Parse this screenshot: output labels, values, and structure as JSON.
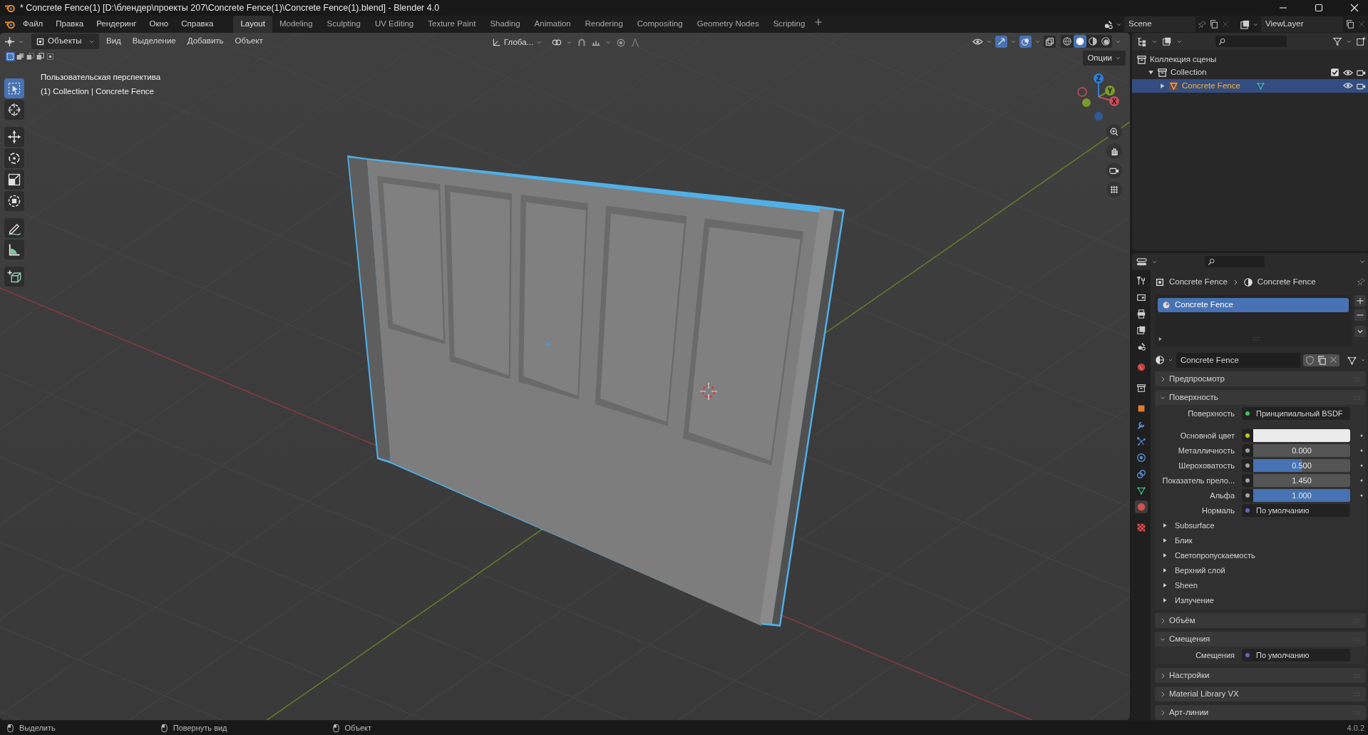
{
  "window": {
    "title": "* Concrete Fence(1) [D:\\блендер\\проекты 207\\Concrete Fence(1)\\Concrete Fence(1).blend] - Blender 4.0"
  },
  "menu": [
    "Файл",
    "Правка",
    "Рендеринг",
    "Окно",
    "Справка"
  ],
  "workspaces": [
    {
      "label": "Layout",
      "selected": true
    },
    {
      "label": "Modeling",
      "selected": false
    },
    {
      "label": "Sculpting",
      "selected": false
    },
    {
      "label": "UV Editing",
      "selected": false
    },
    {
      "label": "Texture Paint",
      "selected": false
    },
    {
      "label": "Shading",
      "selected": false
    },
    {
      "label": "Animation",
      "selected": false
    },
    {
      "label": "Rendering",
      "selected": false
    },
    {
      "label": "Compositing",
      "selected": false
    },
    {
      "label": "Geometry Nodes",
      "selected": false
    },
    {
      "label": "Scripting",
      "selected": false
    }
  ],
  "scene": "Scene",
  "view_layer": "ViewLayer",
  "viewport": {
    "mode": "Объекты",
    "menus": [
      "Вид",
      "Выделение",
      "Добавить",
      "Объект"
    ],
    "orientation": "Глоба...",
    "options": "Опции",
    "toggles": [
      {
        "kind": "gizmo",
        "on": true
      },
      {
        "kind": "overlay",
        "on": true
      },
      {
        "kind": "xray",
        "on": false
      }
    ],
    "shading": [
      {
        "kind": "wire",
        "selected": false
      },
      {
        "kind": "solid",
        "selected": true
      },
      {
        "kind": "material",
        "selected": false
      },
      {
        "kind": "render",
        "selected": false
      }
    ],
    "select_modes": [
      {
        "selected": true
      },
      {
        "selected": false
      },
      {
        "selected": false
      },
      {
        "selected": false
      },
      {
        "selected": false
      }
    ],
    "overlay_text": [
      "Пользовательская перспектива",
      "(1) Collection | Concrete Fence"
    ],
    "tools": [
      {
        "kind": "select",
        "selected": true
      },
      {
        "kind": "cursor",
        "selected": false
      },
      {
        "kind": "move",
        "selected": false
      },
      {
        "kind": "rotate",
        "selected": false
      },
      {
        "kind": "scale",
        "selected": false
      },
      {
        "kind": "transform",
        "selected": false
      },
      {
        "kind": "annotate",
        "selected": false
      },
      {
        "kind": "measure",
        "selected": false
      },
      {
        "kind": "add_cube",
        "selected": false
      }
    ],
    "gizmo_axes": [
      "Z",
      "Y",
      "X"
    ]
  },
  "outliner": {
    "items": [
      {
        "label": "Коллекция сцены",
        "kind": "scene_collection",
        "children": [
          {
            "label": "Collection",
            "kind": "collection",
            "expanded": true,
            "checked": true,
            "selected": false,
            "children": [
              {
                "label": "Concrete Fence",
                "kind": "object",
                "expanded": false,
                "selected": true
              }
            ]
          }
        ]
      }
    ]
  },
  "properties": {
    "tabs": [
      {
        "kind": "tool",
        "selected": false
      },
      {
        "kind": "render",
        "selected": false
      },
      {
        "kind": "output",
        "selected": false
      },
      {
        "kind": "view_layer",
        "selected": false
      },
      {
        "kind": "scene",
        "selected": false
      },
      {
        "kind": "world",
        "selected": false
      },
      {
        "kind": "collection",
        "selected": false
      },
      {
        "kind": "object",
        "selected": false
      },
      {
        "kind": "modifiers",
        "selected": false
      },
      {
        "kind": "particles",
        "selected": false
      },
      {
        "kind": "physics",
        "selected": false
      },
      {
        "kind": "constraints",
        "selected": false
      },
      {
        "kind": "data",
        "selected": false
      },
      {
        "kind": "material",
        "selected": true
      },
      {
        "kind": "texture",
        "selected": false
      }
    ],
    "breadcrumb": [
      "Concrete Fence",
      "Concrete Fence"
    ],
    "material_slots": [
      {
        "label": "Concrete Fence",
        "selected": true
      }
    ],
    "material_name": "Concrete Fence",
    "panels": [
      {
        "title": "Предпросмотр",
        "expanded": false
      },
      {
        "title": "Поверхность",
        "expanded": true,
        "rows": [
          {
            "kind": "link",
            "label": "Поверхность",
            "value": "Принципиальный BSDF",
            "color": "#3fbf5f"
          },
          {
            "kind": "color",
            "label": "Основной цвет",
            "color": "#ebebeb"
          },
          {
            "kind": "slider",
            "label": "Металличность",
            "value": "0.000",
            "level": 0
          },
          {
            "kind": "slider",
            "label": "Шероховатость",
            "value": "0.500",
            "level": 0.5
          },
          {
            "kind": "slider",
            "label": "Показатель прело...",
            "value": "1.450",
            "level": 0
          },
          {
            "kind": "slider",
            "label": "Альфа",
            "value": "1.000",
            "level": 1
          },
          {
            "kind": "link",
            "label": "Нормаль",
            "value": "По умолчанию",
            "color": "#6363c7"
          },
          {
            "kind": "subpanel",
            "label": "Subsurface"
          },
          {
            "kind": "subpanel",
            "label": "Блик"
          },
          {
            "kind": "subpanel",
            "label": "Светопропускаемость"
          },
          {
            "kind": "subpanel",
            "label": "Верхний слой"
          },
          {
            "kind": "subpanel",
            "label": "Sheen"
          },
          {
            "kind": "subpanel",
            "label": "Излучение"
          }
        ]
      },
      {
        "title": "Объём",
        "expanded": false
      },
      {
        "title": "Смещения",
        "expanded": true,
        "rows": [
          {
            "kind": "link",
            "label": "Смещения",
            "value": "По умолчанию",
            "color": "#6363c7"
          }
        ]
      },
      {
        "title": "Настройки",
        "expanded": false
      },
      {
        "title": "Material Library VX",
        "expanded": false
      },
      {
        "title": "Арт-линии",
        "expanded": false
      }
    ]
  },
  "status_bar": {
    "hints": [
      "Выделить",
      "Повернуть вид",
      "Объект"
    ],
    "version": "4.0.2"
  }
}
